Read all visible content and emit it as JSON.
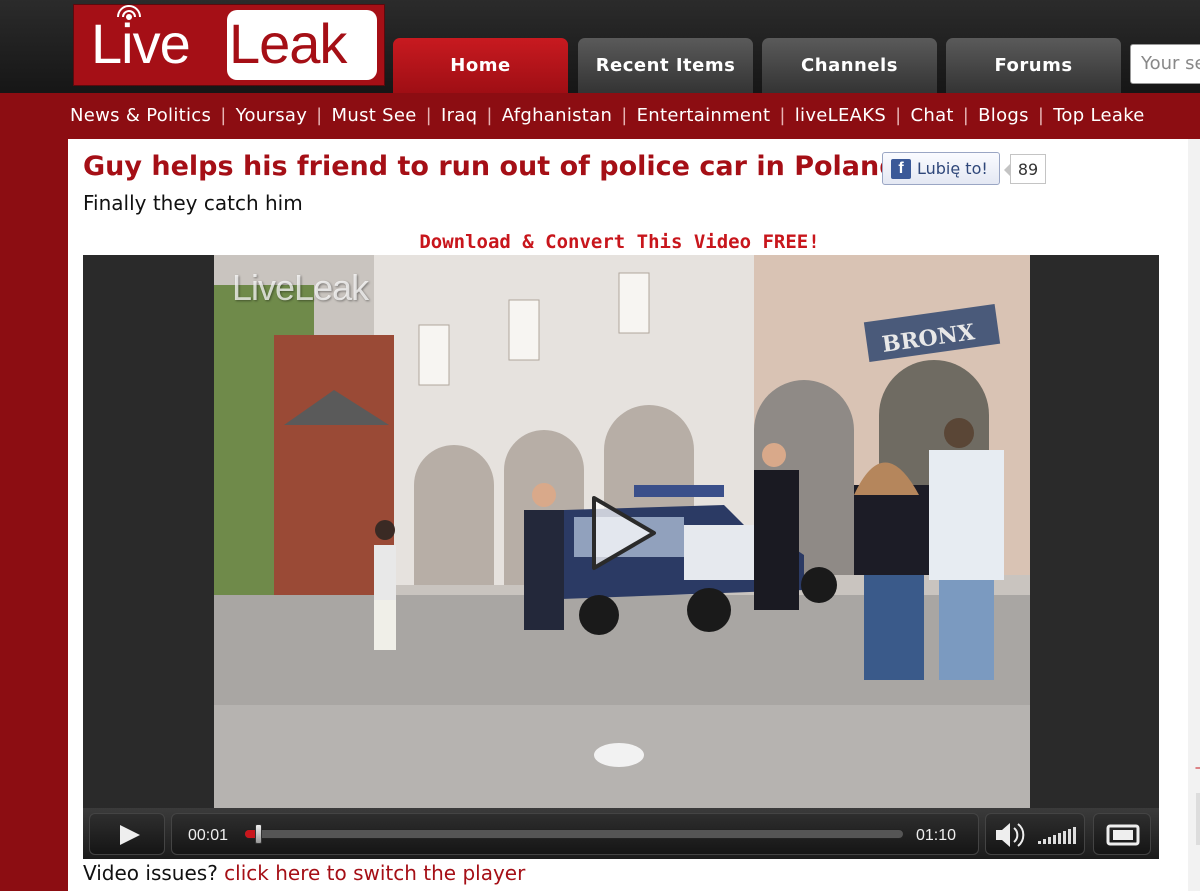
{
  "logo": {
    "live": "Live",
    "leak": "Leak"
  },
  "nav": {
    "tabs": [
      {
        "label": "Home"
      },
      {
        "label": "Recent Items"
      },
      {
        "label": "Channels"
      },
      {
        "label": "Forums"
      }
    ],
    "search_placeholder": "Your se"
  },
  "subnav": {
    "items": [
      "News & Politics",
      "Yoursay",
      "Must See",
      "Iraq",
      "Afghanistan",
      "Entertainment",
      "liveLEAKS",
      "Chat",
      "Blogs",
      "Top Leake"
    ]
  },
  "page": {
    "title": "Guy helps his friend to run out of police car in Poland",
    "subtitle": "Finally they catch him",
    "download_link": "Download & Convert This Video FREE!",
    "like_label": "Lubię to!",
    "like_count": "89"
  },
  "player": {
    "watermark": "LiveLeak",
    "scene_sign": "BRONX",
    "current_time": "00:01",
    "duration": "01:10",
    "progress": 0.02
  },
  "footer": {
    "video_issues_text": "Video issues?",
    "switch_player_link": "click here to switch the player"
  },
  "colors": {
    "brand_red": "#a50f16",
    "link_red": "#c8161c",
    "fb_blue": "#3b5998"
  }
}
